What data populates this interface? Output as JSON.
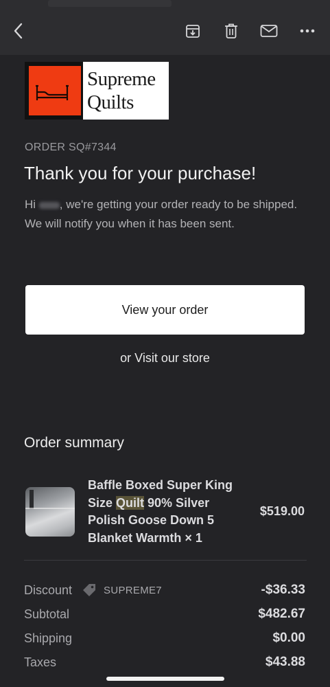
{
  "toolbar": {
    "back_icon": "chevron-left-icon",
    "archive_icon": "archive-icon",
    "delete_icon": "trash-icon",
    "mail_icon": "envelope-icon",
    "more_icon": "more-horizontal-icon"
  },
  "logo": {
    "line1": "Supreme",
    "line2": "Quilts"
  },
  "email": {
    "order_number": "ORDER SQ#7344",
    "headline": "Thank you for your purchase!",
    "greeting": "Hi",
    "intro": ", we're getting your order ready to be shipped. We will notify you when it has been sent.",
    "view_order_label": "View your order",
    "visit_prefix": "or ",
    "visit_link": "Visit our store"
  },
  "summary": {
    "title": "Order summary",
    "item": {
      "name_before": "Baffle Boxed Super King Size ",
      "name_highlight": "Quilt",
      "name_after": " 90% Silver Polish Goose Down 5 Blanket Warmth × 1",
      "price": "$519.00"
    },
    "discount_label": "Discount",
    "discount_code": "SUPREME7",
    "discount_value": "-$36.33",
    "subtotal_label": "Subtotal",
    "subtotal_value": "$482.67",
    "shipping_label": "Shipping",
    "shipping_value": "$0.00",
    "taxes_label": "Taxes",
    "taxes_value": "$43.88"
  },
  "colors": {
    "background": "#232326",
    "toolbar": "#2d2d30",
    "logo_red": "#ef3b12",
    "highlight": "#5a5438"
  }
}
